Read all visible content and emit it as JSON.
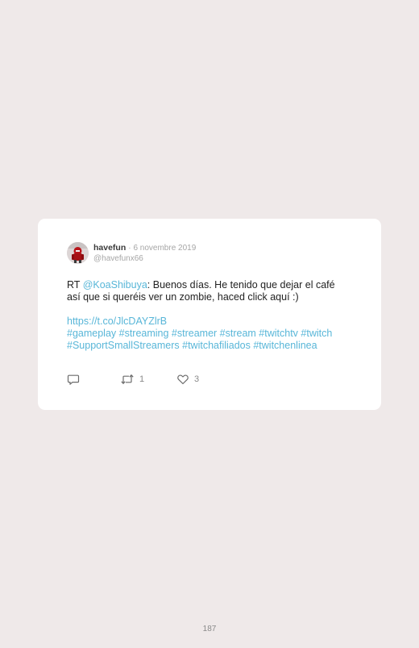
{
  "tweet": {
    "display_name": "havefun",
    "date_separator": "·",
    "date": "6 novembre 2019",
    "handle": "@havefunx66",
    "text_prefix": "RT ",
    "mention": "@KoaShibuya",
    "text_line1_rest": ": Buenos días. He tenido que dejar el café",
    "text_line2": "así que si queréis ver un zombie, haced click aquí :)",
    "link": "https://t.co/JlcDAYZlrB",
    "hashtags_line1": "#gameplay #streaming #streamer #stream #twitchtv #twitch",
    "hashtags_line2": "#SupportSmallStreamers #twitchafiliados #twitchenlinea",
    "actions": {
      "reply_icon": "speech-bubble-icon",
      "retweet_icon": "retweet-icon",
      "retweet_count": "1",
      "like_icon": "heart-icon",
      "like_count": "3"
    }
  },
  "page": {
    "number": "187"
  },
  "colors": {
    "background": "#efe9e9",
    "card": "#ffffff",
    "link": "#58b6d8",
    "muted": "#a6a6a6",
    "text": "#222222"
  }
}
